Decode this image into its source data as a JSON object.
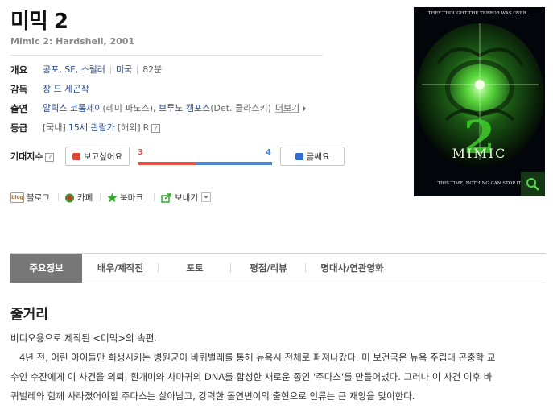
{
  "movie": {
    "title": "미믹 2",
    "subtitle": "Mimic 2: Hardshell, 2001"
  },
  "info": {
    "overview_label": "개요",
    "genres": [
      "공포",
      "SF",
      "스릴러"
    ],
    "country": "미국",
    "runtime": "82분",
    "director_label": "감독",
    "director": "장 드 세곤작",
    "cast_label": "출연",
    "cast_1_name": "알릭스 코롬제이",
    "cast_1_role": "(레미 파노스)",
    "cast_2_name": "브루노 캠포스",
    "cast_2_role": "(Det. 클라스키)",
    "more_label": "더보기",
    "rating_label": "등급",
    "rating_domestic_tag": "[국내]",
    "rating_domestic": "15세 관람가",
    "rating_overseas_tag": "[해외]",
    "rating_overseas": "R"
  },
  "expectation": {
    "label": "기대지수",
    "want_button": "보고싶어요",
    "nah_button": "글쎄요",
    "want_count": "3",
    "nah_count": "4",
    "want_value": 3,
    "nah_value": 4,
    "want_color": "#e6534b",
    "nah_color": "#4a86d8"
  },
  "social": {
    "blog": "블로그",
    "blog_icon_text": "blog",
    "cafe": "카페",
    "bookmark": "북마크",
    "share": "보내기"
  },
  "poster": {
    "tagline_top": "THEY THOUGHT THE TERROR WAS OVER...",
    "big_number": "2",
    "poster_title": "MIMIC",
    "tagline_bottom": "THIS TIME, NOTHING CAN STOP IT",
    "zoom_icon": "search-icon"
  },
  "tabs": [
    {
      "label": "주요정보",
      "active": true
    },
    {
      "label": "배우/제작진",
      "active": false
    },
    {
      "label": "포토",
      "active": false
    },
    {
      "label": "평점/리뷰",
      "active": false
    },
    {
      "label": "명대사/연관영화",
      "active": false
    }
  ],
  "synopsis": {
    "heading": "줄거리",
    "lines": [
      "비디오용으로 제작된 <미믹>의 속편.",
      "   4년 전, 어린 아이들만 희생시키는 병원균이 바퀴벌레를 통해 뉴욕시 전체로 퍼져나갔다. 미 보건국은 뉴욕 주립대 곤충학 교",
      "수인 수잔에게 이 사건을 의뢰, 흰개미와 사마귀의 DNA를 합성한 새로운 종인 '주다스'를 만들어냈다. 그러나 이 사건 이후 바",
      "퀴벌레와 함께 사라졌어야할 주다스는 살아남고, 강력한 돌연변이의 출현으로 인류는 큰 재앙을 맞이한다."
    ]
  }
}
